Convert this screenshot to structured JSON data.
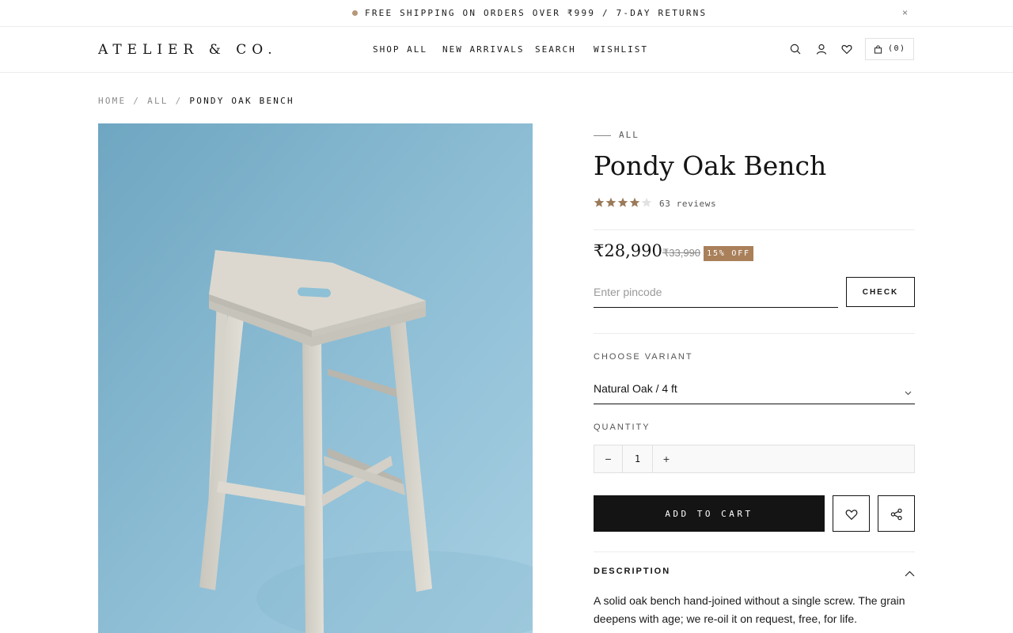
{
  "announcement": {
    "text": "FREE SHIPPING ON ORDERS OVER ₹999 / 7-DAY RETURNS",
    "close": "×"
  },
  "header": {
    "logo": "ATELIER & CO.",
    "nav": [
      "SHOP ALL",
      "NEW ARRIVALS",
      "SEARCH",
      "WISHLIST"
    ],
    "icons": [
      "search-icon",
      "user-icon",
      "heart-icon"
    ],
    "cart_count": "(0)"
  },
  "breadcrumb": {
    "items": [
      "HOME",
      "ALL"
    ],
    "current": "PONDY OAK BENCH"
  },
  "product": {
    "image_alt": "Light oak wooden stool on a blue background",
    "category": "ALL",
    "title": "Pondy Oak Bench",
    "rating": 4,
    "rating_max": 5,
    "reviews": "63 reviews",
    "price": "₹28,990",
    "compare_price": "₹33,990",
    "discount": "15% OFF",
    "pincode_placeholder": "Enter pincode",
    "check_label": "CHECK",
    "variant_label": "CHOOSE VARIANT",
    "variant_value": "Natural Oak / 4 ft",
    "quantity_label": "QUANTITY",
    "quantity": "1",
    "minus": "−",
    "plus": "+",
    "add_to_cart": "ADD TO CART",
    "description_heading": "DESCRIPTION",
    "description": "A solid oak bench hand-joined without a single screw. The grain deepens with age; we re-oil it on request, free, for life."
  },
  "colors": {
    "accent": "#a9805a",
    "dark": "#141414",
    "photo_bg": "#8fbfd6"
  }
}
